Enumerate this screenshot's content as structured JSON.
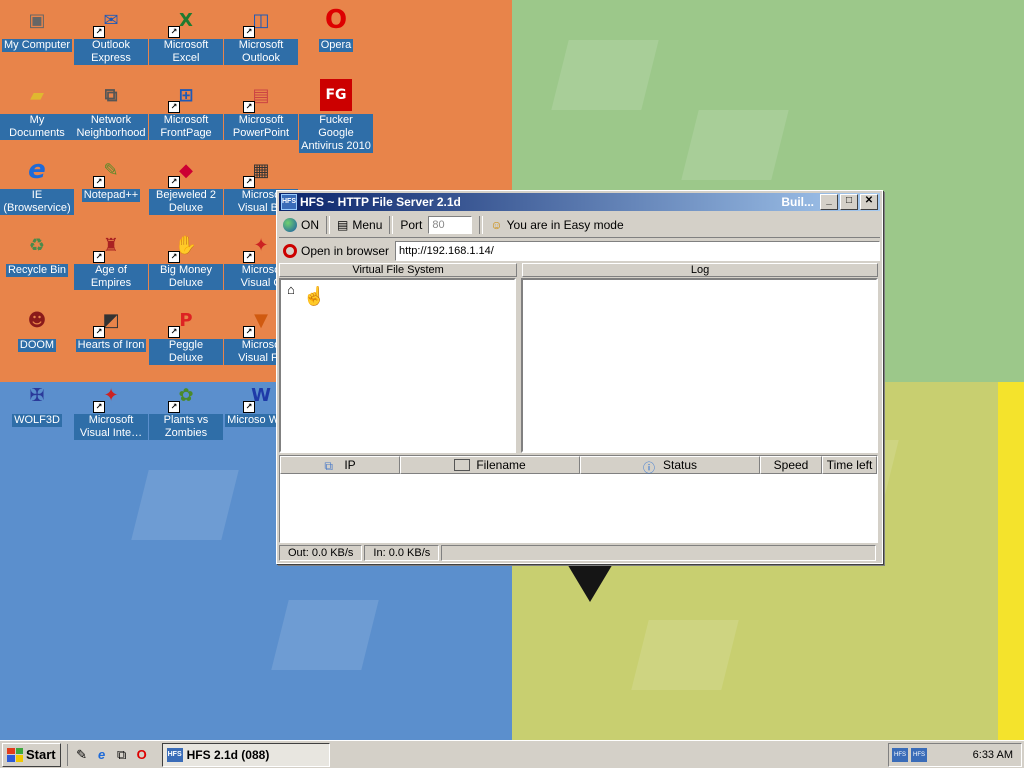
{
  "desktop": {
    "icons": [
      {
        "label": "My Computer",
        "icon": "my-computer-icon"
      },
      {
        "label": "Outlook Express",
        "icon": "outlook-express-icon"
      },
      {
        "label": "Microsoft Excel",
        "icon": "excel-icon"
      },
      {
        "label": "Microsoft Outlook",
        "icon": "outlook-icon"
      },
      {
        "label": "Opera",
        "icon": "opera-icon"
      },
      {
        "label": "My Documents",
        "icon": "my-documents-icon"
      },
      {
        "label": "Network Neighborhood",
        "icon": "network-icon"
      },
      {
        "label": "Microsoft FrontPage",
        "icon": "frontpage-icon"
      },
      {
        "label": "Microsoft PowerPoint",
        "icon": "powerpoint-icon"
      },
      {
        "label": "Fucker Google Antivirus 2010",
        "icon": "antivirus-icon"
      },
      {
        "label": "IE (Browservice)",
        "icon": "ie-icon"
      },
      {
        "label": "Notepad++",
        "icon": "notepad-icon"
      },
      {
        "label": "Bejeweled 2 Deluxe",
        "icon": "bejeweled-icon"
      },
      {
        "label": "Microso Visual Ba",
        "icon": "visual-basic-icon"
      },
      {
        "label": "Recycle Bin",
        "icon": "recycle-bin-icon"
      },
      {
        "label": "Age of Empires",
        "icon": "age-of-empires-icon"
      },
      {
        "label": "Big Money Deluxe",
        "icon": "big-money-icon"
      },
      {
        "label": "Microso Visual C",
        "icon": "visual-c-icon"
      },
      {
        "label": "DOOM",
        "icon": "doom-icon"
      },
      {
        "label": "Hearts of Iron",
        "icon": "hearts-of-iron-icon"
      },
      {
        "label": "Peggle Deluxe",
        "icon": "peggle-icon"
      },
      {
        "label": "Microso Visual Fo",
        "icon": "visual-foxpro-icon"
      },
      {
        "label": "WOLF3D",
        "icon": "wolf3d-icon"
      },
      {
        "label": "Microsoft Visual Inte…",
        "icon": "visual-interdev-icon"
      },
      {
        "label": "Plants vs Zombies",
        "icon": "plants-vs-zombies-icon"
      },
      {
        "label": "Microso Word",
        "icon": "word-icon"
      }
    ]
  },
  "window": {
    "title": "HFS ~ HTTP File Server 2.1d",
    "build_label": "Buil...",
    "app_badge": "HFS",
    "toolbar": {
      "on_label": "ON",
      "menu_label": "Menu",
      "port_label": "Port",
      "port_value": "80",
      "mode_label": "You are in Easy mode"
    },
    "browser": {
      "open_label": "Open in browser",
      "url": "http://192.168.1.14/"
    },
    "panels": {
      "vfs_title": "Virtual File System",
      "log_title": "Log"
    },
    "connections": {
      "columns": [
        "IP",
        "Filename",
        "Status",
        "Speed",
        "Time left"
      ]
    },
    "status": {
      "out": "Out: 0.0 KB/s",
      "in": "In: 0.0 KB/s"
    }
  },
  "taskbar": {
    "start_label": "Start",
    "task_label": "HFS 2.1d (088)",
    "tray_badges": [
      "HFS",
      "HFS"
    ],
    "clock": "6:33 AM"
  },
  "colors": {
    "title_start": "#0a246a",
    "title_end": "#a6caf0",
    "icon_label_bg": "#2f6ea8"
  }
}
